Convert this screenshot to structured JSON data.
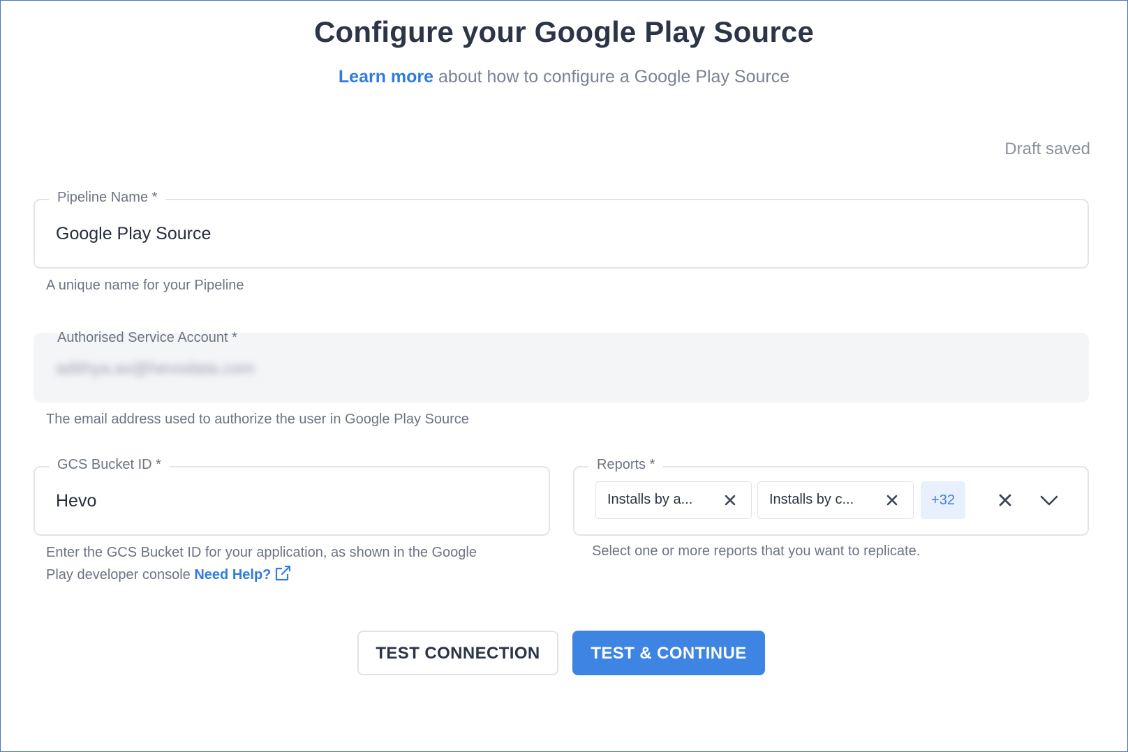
{
  "header": {
    "title": "Configure your Google Play Source",
    "learn_more": "Learn more",
    "subtitle_rest": " about how to configure a Google Play Source"
  },
  "status": {
    "draft": "Draft saved"
  },
  "pipeline_name": {
    "label": "Pipeline Name *",
    "value": "Google Play Source",
    "hint": "A unique name for your Pipeline"
  },
  "service_account": {
    "label": "Authorised Service Account *",
    "value": "adithya.ax@hevodata.com",
    "hint": "The email address used to authorize the user in Google Play Source"
  },
  "gcs_bucket": {
    "label": "GCS Bucket ID *",
    "value": "Hevo",
    "hint_line1": "Enter the GCS Bucket ID for your application, as shown in the Google",
    "hint_line2": "Play developer console ",
    "help_link": "Need Help?"
  },
  "reports": {
    "label": "Reports *",
    "chips": [
      "Installs by a...",
      "Installs by c..."
    ],
    "more": "+32",
    "hint": "Select one or more reports that you want to replicate."
  },
  "actions": {
    "test_connection": "TEST CONNECTION",
    "test_continue": "TEST & CONTINUE"
  },
  "colors": {
    "accent": "#3d84e3",
    "link": "#2f7be0",
    "frame_border": "#4a72c4"
  }
}
